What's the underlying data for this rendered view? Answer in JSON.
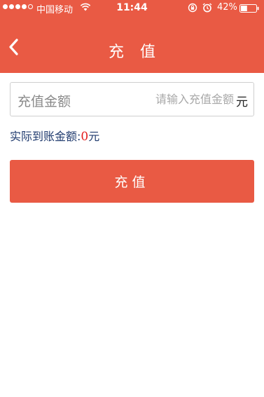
{
  "status_bar": {
    "carrier": "中国移动",
    "time": "11:44",
    "battery_percent": "42%",
    "battery_level": 0.42
  },
  "nav": {
    "title": "充 值"
  },
  "form": {
    "amount_label": "充值金额",
    "amount_value": "",
    "amount_placeholder": "请输入充值金额",
    "amount_unit": "元"
  },
  "actual": {
    "label": "实际到账金额:",
    "value": "0",
    "unit": "元"
  },
  "submit": {
    "label": "充值"
  },
  "colors": {
    "accent": "#e95a44",
    "highlight": "#e31b1b",
    "label_text": "#1f3a6e"
  },
  "icons": {
    "back": "chevron-left-icon",
    "wifi": "wifi-icon",
    "rotation_lock": "rotation-lock-icon",
    "alarm": "alarm-icon",
    "battery": "battery-icon"
  }
}
